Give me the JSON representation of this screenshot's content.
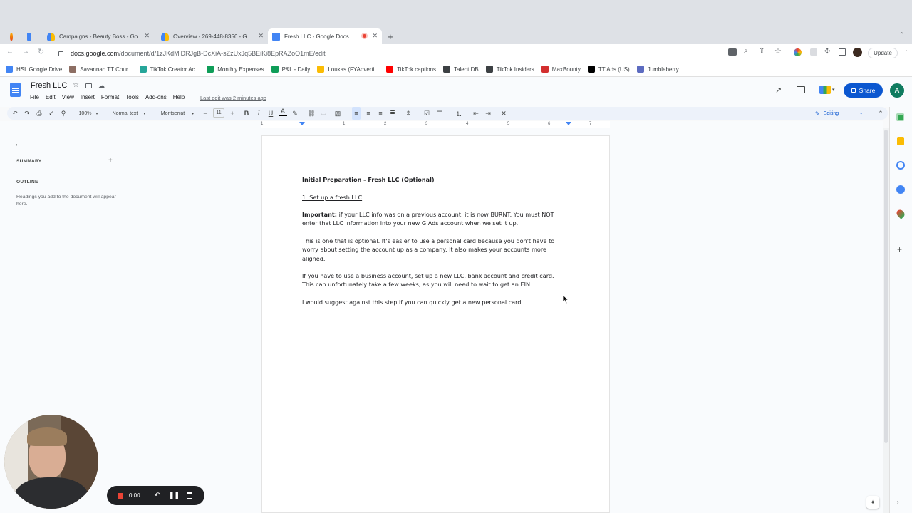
{
  "browser": {
    "tabs": [
      {
        "title": "",
        "icon": "firefox-like-fire-icon"
      },
      {
        "title": "",
        "icon": "google-docs-icon"
      },
      {
        "title": "Campaigns - Beauty Boss - Go",
        "icon": "google-ads-icon"
      },
      {
        "title": "Overview - 269-448-8356 - G",
        "icon": "google-ads-icon"
      },
      {
        "title": "Fresh LLC - Google Docs",
        "icon": "google-docs-icon"
      }
    ],
    "url_host": "docs.google.com",
    "url_path": "/document/d/1zJKdMiDRJgB-DcXiA-sZzUxJq5BEiKi8EpRAZoO1mE/edit",
    "update_label": "Update",
    "profile_initial": "A",
    "bookmarks": [
      {
        "label": "HSL Google Drive",
        "color": "#4285f4"
      },
      {
        "label": "Savannah TT Cour...",
        "color": "#8d6e63"
      },
      {
        "label": "TikTok Creator Ac...",
        "color": "#26a69a"
      },
      {
        "label": "Monthly Expenses",
        "color": "#0f9d58"
      },
      {
        "label": "P&L - Daily",
        "color": "#0f9d58"
      },
      {
        "label": "Loukas (FYAdverti...",
        "color": "#fbbc04"
      },
      {
        "label": "TikTok captions",
        "color": "#ff0000"
      },
      {
        "label": "Talent DB",
        "color": "#3c4043"
      },
      {
        "label": "TikTok Insiders",
        "color": "#3c4043"
      },
      {
        "label": "MaxBounty",
        "color": "#d32f2f"
      },
      {
        "label": "TT Ads (US)",
        "color": "#000000"
      },
      {
        "label": "Jumbleberry",
        "color": "#5c6bc0"
      }
    ]
  },
  "docs": {
    "title": "Fresh LLC",
    "menu": [
      "File",
      "Edit",
      "View",
      "Insert",
      "Format",
      "Tools",
      "Add-ons",
      "Help"
    ],
    "last_edit": "Last edit was 2 minutes ago",
    "share_label": "Share",
    "toolbar": {
      "zoom": "100%",
      "style": "Normal text",
      "font": "Montserrat",
      "size": "11",
      "mode": "Editing"
    },
    "ruler_ticks": [
      "1",
      "1",
      "2",
      "3",
      "4",
      "5",
      "6",
      "7"
    ],
    "outline": {
      "summary_label": "SUMMARY",
      "outline_label": "OUTLINE",
      "hint": "Headings you add to the document will appear here."
    },
    "content": {
      "heading": "Initial Preparation - Fresh LLC (Optional)",
      "subheading": "1. Set up a fresh LLC",
      "p1_bold": "Important:",
      "p1_rest": " if your LLC info was on a previous account, it is now BURNT. You must NOT enter that LLC information into your new G Ads account when we set it up.",
      "p2": "This is one that is optional. It's easier to use a personal card because you don't have to worry about setting the account up as a company. It also makes your accounts more aligned.",
      "p3": "If you have to use a business account, set up a new LLC, bank account and credit card. This can unfortunately take a few weeks, as you will need to wait to get an EIN.",
      "p4": "I would suggest against this step if you can quickly get a new personal card."
    }
  },
  "recorder": {
    "time": "0:00"
  },
  "colors": {
    "accent": "#0b57d0",
    "docs_blue": "#4285f4",
    "record_red": "#ea4335"
  }
}
